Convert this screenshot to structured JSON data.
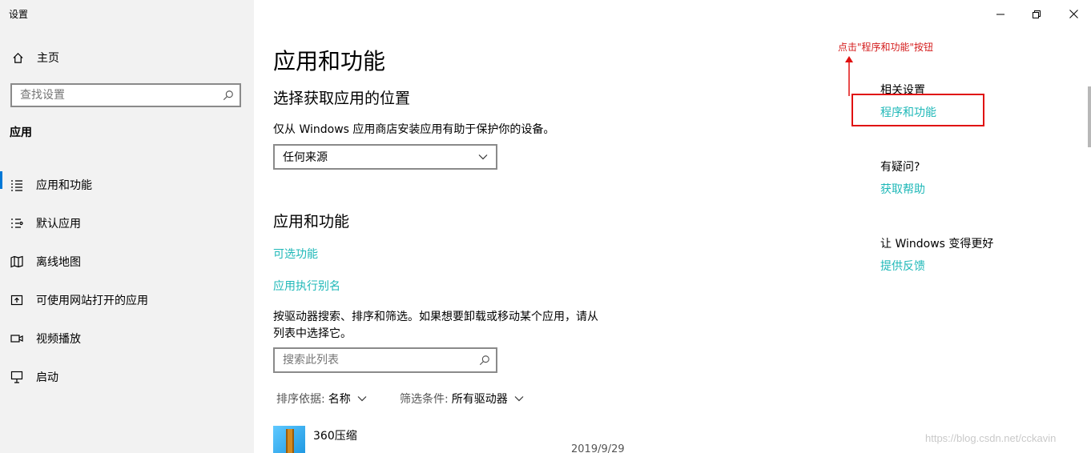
{
  "window": {
    "title": "设置",
    "controls": [
      "minimize-icon",
      "restore-icon",
      "close-icon"
    ]
  },
  "sidebar": {
    "home_label": "主页",
    "search_placeholder": "查找设置",
    "section_label": "应用",
    "items": [
      {
        "label": "应用和功能",
        "icon": "apps-list-icon",
        "active": true
      },
      {
        "label": "默认应用",
        "icon": "default-apps-icon",
        "active": false
      },
      {
        "label": "离线地图",
        "icon": "map-icon",
        "active": false
      },
      {
        "label": "可使用网站打开的应用",
        "icon": "open-in-web-icon",
        "active": false
      },
      {
        "label": "视频播放",
        "icon": "video-icon",
        "active": false
      },
      {
        "label": "启动",
        "icon": "startup-icon",
        "active": false
      }
    ]
  },
  "main": {
    "title": "应用和功能",
    "source_heading": "选择获取应用的位置",
    "source_desc": "仅从 Windows 应用商店安装应用有助于保护你的设备。",
    "source_selected": "任何来源",
    "apps_heading": "应用和功能",
    "optional_features_link": "可选功能",
    "app_alias_link": "应用执行别名",
    "search_desc_line1": "按驱动器搜索、排序和筛选。如果想要卸载或移动某个应用，请从",
    "search_desc_line2": "列表中选择它。",
    "list_search_placeholder": "搜索此列表",
    "sort_label": "排序依据:",
    "sort_value": "名称",
    "filter_label": "筛选条件:",
    "filter_value": "所有驱动器",
    "apps": [
      {
        "name": "360压缩",
        "date": "2019/9/29"
      }
    ]
  },
  "right": {
    "related_title": "相关设置",
    "programs_link": "程序和功能",
    "question_title": "有疑问?",
    "help_link": "获取帮助",
    "improve_title": "让 Windows 变得更好",
    "feedback_link": "提供反馈"
  },
  "annotation": {
    "text": "点击\"程序和功能\"按钮",
    "color": "#d41c1c"
  },
  "watermark": "https://blog.csdn.net/cckavin",
  "colors": {
    "accent": "#1fb8b8",
    "sidebar_bg": "#f2f2f2",
    "highlight": "#e01010"
  }
}
